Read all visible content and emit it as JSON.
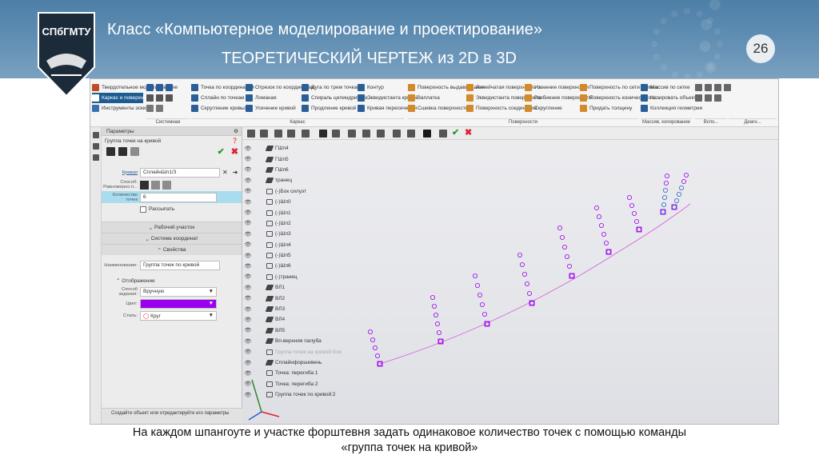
{
  "slide": {
    "title_line1": "Класс «Компьютерное моделирование и проектирование»",
    "title_line2": "ТЕОРЕТИЧЕСКИЙ ЧЕРТЕЖ из 2D в 3D",
    "page_number": "26",
    "logo_text": "СПбГМТУ",
    "caption_line1": "На каждом шпангоуте и участке форштевня задать одинаковое количество точек с помощью команды",
    "caption_line2": "«группа точек на кривой»"
  },
  "ribbon": {
    "col1": [
      "Твердотельное моделирование",
      "Каркас и поверхности",
      "Инструменты эскиза"
    ],
    "col3": [
      "Точка по координатам",
      "Сплайн по точкам",
      "Скругление кривых"
    ],
    "col4": [
      "Отрезок по координатам",
      "Ломаная",
      "Усечение кривой"
    ],
    "col5": [
      "Дуга по трем точкам",
      "Спираль цилиндрическ...",
      "Продление кривой"
    ],
    "col6": [
      "Контур",
      "Эквидистанта кривой",
      "Кривая пересечения"
    ],
    "col7": [
      "Поверхность выдавливания",
      "Заплатка",
      "Сшивка поверхностей"
    ],
    "col8": [
      "Линейчатая поверхность п...",
      "Эквидистанта поверхности",
      "Поверхность соединения"
    ],
    "col9": [
      "Усечение поверхности",
      "Разбиение поверхности",
      "Скругление"
    ],
    "col10": [
      "Поверхность по сети кривых",
      "Поверхность конического с...",
      "Придать толщину"
    ],
    "col11": [
      "Массив по сетке",
      "Копировать объекты",
      "Коллекция геометрии"
    ],
    "groups": [
      "Системная",
      "Каркас",
      "Поверхности",
      "Массив, копирование",
      "Вспо...",
      "Диагн..."
    ]
  },
  "panel": {
    "title": "Параметры",
    "subtitle": "Группа точек на кривой",
    "curve_label": "Кривая",
    "curve_value": "СплайнШп1/3",
    "method_label": "Способ: Равномерно п...",
    "count_label": "Количество точек",
    "count_value": "6",
    "scatter_label": "Рассыпать",
    "section_work": "Рабочий участок",
    "section_coords": "Система координат",
    "section_props": "Свойства",
    "name_label": "Наименование:",
    "name_value": "Группа точек по кривой",
    "section_display": "Отображение",
    "method2_label": "Способ задания:",
    "method2_value": "Вручную",
    "color_label": "Цвет:",
    "color_value": "#9900ee",
    "style_label": "Стиль:",
    "style_value": "Круг",
    "footer_text": "Создайте объект или отредактируйте его параметры"
  },
  "tree": [
    {
      "label": "ГШп4",
      "type": "curve"
    },
    {
      "label": "ГШп5",
      "type": "curve"
    },
    {
      "label": "ГШп6",
      "type": "curve"
    },
    {
      "label": "транец",
      "type": "curve"
    },
    {
      "label": "(-)Бок силуэт",
      "type": "sketch"
    },
    {
      "label": "(-)Шп0",
      "type": "sketch"
    },
    {
      "label": "(-)Шп1",
      "type": "sketch"
    },
    {
      "label": "(-)Шп2",
      "type": "sketch"
    },
    {
      "label": "(-)Шп3",
      "type": "sketch"
    },
    {
      "label": "(-)Шп4",
      "type": "sketch"
    },
    {
      "label": "(-)Шп5",
      "type": "sketch"
    },
    {
      "label": "(-)Шп6",
      "type": "sketch"
    },
    {
      "label": "(-)транец",
      "type": "sketch"
    },
    {
      "label": "ВЛ1",
      "type": "curve"
    },
    {
      "label": "ВЛ2",
      "type": "curve"
    },
    {
      "label": "ВЛ3",
      "type": "curve"
    },
    {
      "label": "ВЛ4",
      "type": "curve"
    },
    {
      "label": "ВЛ5",
      "type": "curve"
    },
    {
      "label": "Вп-верхняя палуба",
      "type": "curve"
    },
    {
      "label": "Группа точек на кривой Бок",
      "type": "faded"
    },
    {
      "label": "Сплайнфоршевень",
      "type": "curve"
    },
    {
      "label": "Точка: перегиба 1",
      "type": "point"
    },
    {
      "label": "Точка: перегиба 2",
      "type": "point"
    },
    {
      "label": "Группа точек по кривой:2",
      "type": "group"
    }
  ],
  "colors": {
    "header": "#5a88ae",
    "accent": "#9900ee",
    "selection": "#1c5c91"
  }
}
